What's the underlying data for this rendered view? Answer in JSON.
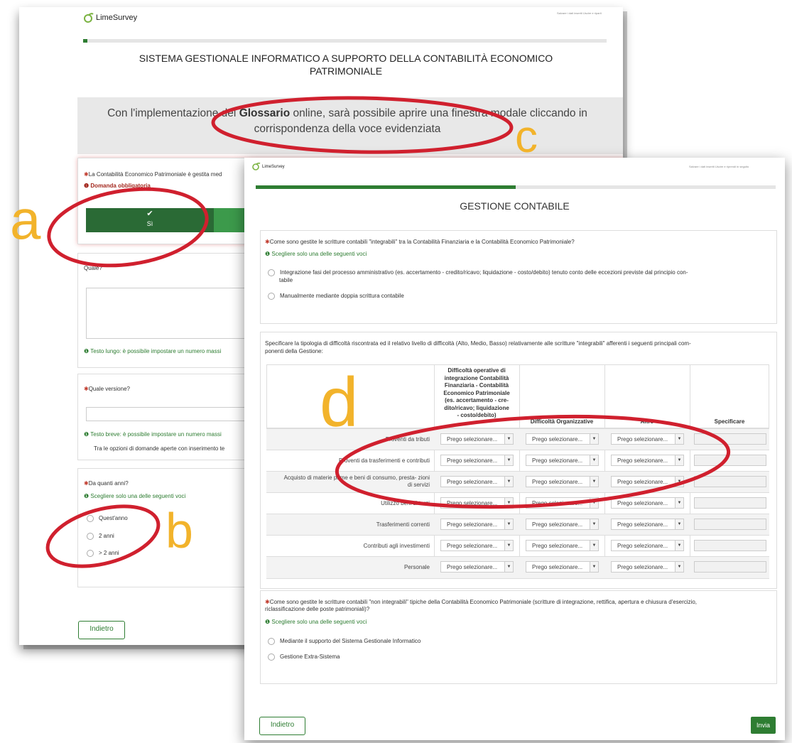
{
  "back_window": {
    "logo": "LimeSurvey",
    "top_links": "Salvare i dati inseriti   Uscire e riparti",
    "title": "SISTEMA GESTIONALE INFORMATICO A SUPPORTO DELLA CONTABILITÀ ECONOMICO PATRIMONIALE",
    "glossary_prefix": "Con l'implementazione del ",
    "glossary_bold": "Glossario",
    "glossary_suffix": " online, sarà possibile aprire una finestra modale cliccando in corrispondenza della voce evidenziata",
    "q1_text": "La Contabilità Economico Patrimoniale è gestita med",
    "q1_mandatory": "Domanda obbligatoria",
    "q1_yes": "Sì",
    "q2_text": "Quale?",
    "q2_help": "Testo lungo: è possibile impostare un numero massi",
    "q3_text": "Quale versione?",
    "q3_help": "Testo breve: è possibile impostare un numero massi",
    "q3_note": "Tra le opzioni di domande aperte con inserimento te",
    "q4_text": "Da quanti anni?",
    "q4_help": "Scegliere solo una delle seguenti voci",
    "q4_options": [
      "Quest'anno",
      "2 anni",
      "> 2 anni"
    ],
    "back_button": "Indietro"
  },
  "front_window": {
    "logo": "LimeSurvey",
    "top_links": "Salvare i dati inseriti   Uscire e riprendi in seguito",
    "progress": 0.5,
    "title": "GESTIONE CONTABILE",
    "q1_text": "Come sono gestite le scritture contabili \"integrabili\" tra la Contabilità Finanziaria e la Contabilità Economico Patrimoniale?",
    "q1_help": "Scegliere solo una delle seguenti voci",
    "q1_option1_line1": "Integrazione fasi del processo amministrativo (es. accertamento - credito/ricavo; liquidazione - costo/debito) tenuto conto delle eccezioni previste dal principio con-",
    "q1_option1_line2": "tabile",
    "q1_option2": "Manualmente mediante doppia scrittura contabile",
    "q2_text_line1": "Specificare la tipologia di difficoltà riscontrata ed il relativo livello di difficoltà (Alto, Medio, Basso) relativamente alle scritture \"integrabili\" afferenti i seguenti principali com-",
    "q2_text_line2": "ponenti della Gestione:",
    "col1_lines": [
      "Difficoltà operative di",
      "integrazione Contabilità",
      "Finanziaria - Contabilità",
      "Economico Patrimoniale",
      "(es. accertamento - cre-",
      "dito/ricavo; liquidazione",
      "- costo/debito)"
    ],
    "col2": "Difficoltà Organizzative",
    "col3": "Altro",
    "col4": "Specificare",
    "rows": [
      "Proventi da tributi",
      "Proventi da trasferimenti e contributi",
      "Acquisto di materie prime e beni di consumo, presta- zioni di servizi",
      "Utilizzo beni di terzi",
      "Trasferimenti correnti",
      "Contributi agli investimenti",
      "Personale"
    ],
    "select_placeholder": "Prego selezionare...",
    "q3_text_line1": "Come sono gestite le scritture contabili \"non integrabili\" tipiche della Contabilità Economico Patrimoniale (scritture di integrazione, rettifica, apertura e chiusura d'esercizio,",
    "q3_text_line2": "riclassificazione delle poste patrimoniali)?",
    "q3_help": "Scegliere solo una delle seguenti voci",
    "q3_options": [
      "Mediante il supporto del Sistema Gestionale Informatico",
      "Gestione Extra-Sistema"
    ],
    "back_button": "Indietro",
    "submit_button": "Invia"
  },
  "markers": [
    "a",
    "b",
    "c",
    "d"
  ],
  "colors": {
    "accent_green": "#2e7d32",
    "annotation_red": "#d0202e",
    "marker_yellow": "#f2b32b"
  }
}
